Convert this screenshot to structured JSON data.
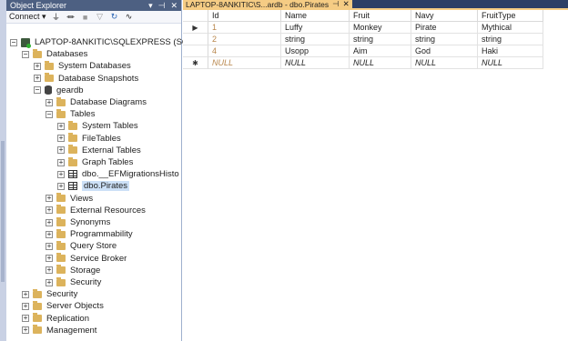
{
  "object_explorer": {
    "title": "Object Explorer",
    "title_buttons": [
      "▾",
      "⊣",
      "✕"
    ],
    "toolbar": {
      "connect_label": "Connect ▾",
      "icons": [
        "connect-plug-icon",
        "disconnect-icon",
        "filter-icon",
        "refresh-icon",
        "activity-icon"
      ]
    },
    "tree": [
      {
        "label": "LAPTOP-8ANKITIC\\SQLEXPRESS (SQL S",
        "indent": 0,
        "icon": "server-icon",
        "exp": "−"
      },
      {
        "label": "Databases",
        "indent": 1,
        "icon": "folder-icon",
        "exp": "−"
      },
      {
        "label": "System Databases",
        "indent": 2,
        "icon": "folder-icon",
        "exp": "+"
      },
      {
        "label": "Database Snapshots",
        "indent": 2,
        "icon": "folder-icon",
        "exp": "+"
      },
      {
        "label": "geardb",
        "indent": 2,
        "icon": "database-icon",
        "exp": "−"
      },
      {
        "label": "Database Diagrams",
        "indent": 3,
        "icon": "folder-icon",
        "exp": "+"
      },
      {
        "label": "Tables",
        "indent": 3,
        "icon": "folder-icon",
        "exp": "−"
      },
      {
        "label": "System Tables",
        "indent": 4,
        "icon": "folder-icon",
        "exp": "+"
      },
      {
        "label": "FileTables",
        "indent": 4,
        "icon": "folder-icon",
        "exp": "+"
      },
      {
        "label": "External Tables",
        "indent": 4,
        "icon": "folder-icon",
        "exp": "+"
      },
      {
        "label": "Graph Tables",
        "indent": 4,
        "icon": "folder-icon",
        "exp": "+"
      },
      {
        "label": "dbo.__EFMigrationsHisto",
        "indent": 4,
        "icon": "table-icon",
        "exp": "+"
      },
      {
        "label": "dbo.Pirates",
        "indent": 4,
        "icon": "table-icon",
        "exp": "+",
        "selected": true
      },
      {
        "label": "Views",
        "indent": 3,
        "icon": "folder-icon",
        "exp": "+"
      },
      {
        "label": "External Resources",
        "indent": 3,
        "icon": "folder-icon",
        "exp": "+"
      },
      {
        "label": "Synonyms",
        "indent": 3,
        "icon": "folder-icon",
        "exp": "+"
      },
      {
        "label": "Programmability",
        "indent": 3,
        "icon": "folder-icon",
        "exp": "+"
      },
      {
        "label": "Query Store",
        "indent": 3,
        "icon": "folder-icon",
        "exp": "+"
      },
      {
        "label": "Service Broker",
        "indent": 3,
        "icon": "folder-icon",
        "exp": "+"
      },
      {
        "label": "Storage",
        "indent": 3,
        "icon": "folder-icon",
        "exp": "+"
      },
      {
        "label": "Security",
        "indent": 3,
        "icon": "folder-icon",
        "exp": "+"
      },
      {
        "label": "Security",
        "indent": 1,
        "icon": "folder-icon",
        "exp": "+"
      },
      {
        "label": "Server Objects",
        "indent": 1,
        "icon": "folder-icon",
        "exp": "+"
      },
      {
        "label": "Replication",
        "indent": 1,
        "icon": "folder-icon",
        "exp": "+"
      },
      {
        "label": "Management",
        "indent": 1,
        "icon": "folder-icon",
        "exp": "+"
      }
    ]
  },
  "document_tab": {
    "label": "LAPTOP-8ANKITIC\\S...ardb - dbo.Pirates",
    "pin": "⊣",
    "close": "✕"
  },
  "grid": {
    "columns": [
      "Id",
      "Name",
      "Fruit",
      "Navy",
      "FruitType"
    ],
    "rows": [
      {
        "marker": "▶",
        "cells": [
          "1",
          "Luffy",
          "Monkey",
          "Pirate",
          "Mythical"
        ]
      },
      {
        "marker": "",
        "cells": [
          "2",
          "string",
          "string",
          "string",
          "string"
        ]
      },
      {
        "marker": "",
        "cells": [
          "4",
          "Usopp",
          "Aim",
          "God",
          "Haki"
        ]
      },
      {
        "marker": "✱",
        "cells": [
          "NULL",
          "NULL",
          "NULL",
          "NULL",
          "NULL"
        ],
        "is_new": true
      }
    ]
  },
  "colors": {
    "title_bar": "#4d6082",
    "tab_active": "#f5cc84",
    "tab_strip": "#2d3f66",
    "folder": "#dcb35c",
    "id_value": "#b8864b",
    "selection": "#cce0f7"
  }
}
